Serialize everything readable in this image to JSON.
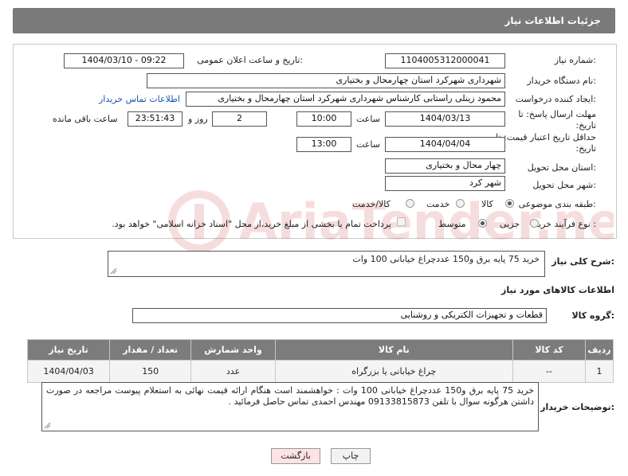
{
  "header": {
    "title": "جزئیات اطلاعات نیاز"
  },
  "fields": {
    "need_number_label": "شماره نیاز:",
    "need_number": "1104005312000041",
    "announce_label": "تاریخ و ساعت اعلان عمومی:",
    "announce_value": "1404/03/10 - 09:22",
    "buyer_org_label": "نام دستگاه خریدار:",
    "buyer_org": "شهرداری شهرکرد استان چهارمحال و بختیاری",
    "creator_label": "ایجاد کننده درخواست:",
    "creator": "محمود زینلی راستابی کارشناس شهرداری شهرکرد استان چهارمحال و بختیاری",
    "buyer_contact_link": "اطلاعات تماس خریدار",
    "deadline_label": "مهلت ارسال پاسخ: تا تاریخ:",
    "deadline_date": "1404/03/13",
    "time_label": "ساعت",
    "deadline_time": "10:00",
    "days_count": "2",
    "days_label": "روز و",
    "remaining_time": "23:51:43",
    "remaining_label": "ساعت باقی مانده",
    "price_validity_label": "حداقل تاریخ اعتبار قیمت: تا تاریخ:",
    "price_date": "1404/04/04",
    "price_time": "13:00",
    "province_label": "استان محل تحویل:",
    "province": "چهار محال و بختیاری",
    "city_label": "شهر محل تحویل:",
    "city": "شهر کرد",
    "category_label": "طبقه بندی موضوعی:",
    "category_options": [
      "کالا",
      "خدمت",
      "کالا/خدمت"
    ],
    "process_label": "نوع فرآیند خرید :",
    "process_options": [
      "جزیی",
      "متوسط"
    ],
    "payment_note": "پرداخت تمام یا بخشی از مبلغ خرید،از محل \"اسناد خزانه اسلامی\" خواهد بود."
  },
  "general_desc": {
    "label": "شرح کلی نیاز:",
    "text": "خرید 75 پایه برق و150 عددچراغ خیابانی 100 وات"
  },
  "goods": {
    "section_title": "اطلاعات کالاهای مورد نیاز",
    "group_label": "گروه کالا:",
    "group_value": "قطعات و تجهیزات الکتریکی و روشنایی",
    "columns": [
      "ردیف",
      "کد کالا",
      "نام کالا",
      "واحد شمارش",
      "تعداد / مقدار",
      "تاریخ نیاز"
    ],
    "rows": [
      {
        "row": "1",
        "code": "--",
        "name": "چراغ خیابانی یا بزرگراه",
        "unit": "عدد",
        "qty": "150",
        "date": "1404/04/03"
      }
    ]
  },
  "buyer_notes": {
    "label": "توضیحات خریدار:",
    "text": "خرید 75 پایه برق و150 عددچراغ خیابانی 100 وات : خواهشمند است هنگام ارائه قیمت نهائی به استعلام پیوست مراجعه در صورت داشتن هرگونه سوال با تلفن 09133815873 مهندس احمدی تماس حاصل فرمائید ."
  },
  "buttons": {
    "print": "چاپ",
    "back": "بازگشت"
  },
  "watermark": "AriaTender.neT",
  "colors": {
    "header_bg": "#7a7a7a",
    "link": "#1a56b0",
    "back_button_bg": "#fde3e3"
  }
}
